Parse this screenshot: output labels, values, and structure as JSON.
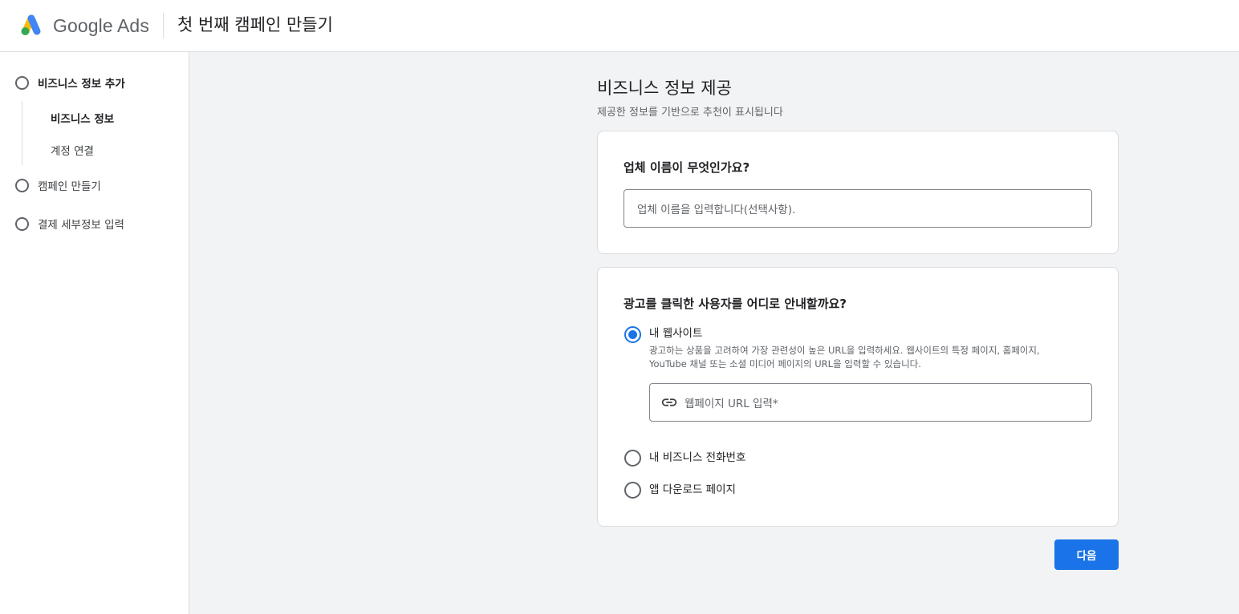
{
  "header": {
    "brand": "Google Ads",
    "title": "첫 번째 캠페인 만들기",
    "logo_colors": {
      "blue": "#4285F4",
      "yellow": "#FBBC04",
      "green": "#34A853"
    }
  },
  "sidebar": {
    "steps": [
      {
        "label": "비즈니스 정보 추가",
        "state": "current"
      },
      {
        "label": "캠페인 만들기",
        "state": "pending"
      },
      {
        "label": "결제 세부정보 입력",
        "state": "pending"
      }
    ],
    "substeps": [
      {
        "label": "비즈니스 정보",
        "active": true
      },
      {
        "label": "계정 연결",
        "active": false
      }
    ]
  },
  "main": {
    "title": "비즈니스 정보 제공",
    "subtitle": "제공한 정보를 기반으로 추천이 표시됩니다",
    "business_name": {
      "question": "업체 이름이 무엇인가요?",
      "placeholder": "업체 이름을 입력합니다(선택사항).",
      "value": ""
    },
    "destination": {
      "question": "광고를 클릭한 사용자를 어디로 안내할까요?",
      "options": [
        {
          "label": "내 웹사이트",
          "checked": true
        },
        {
          "label": "내 비즈니스 전화번호",
          "checked": false
        },
        {
          "label": "앱 다운로드 페이지",
          "checked": false
        }
      ],
      "website_desc_line1": "광고하는 상품을 고려하여 가장 관련성이 높은 URL을 입력하세요. 웹사이트의 특정 페이지, 홈페이지,",
      "website_desc_line2": "YouTube 채널 또는 소셜 미디어 페이지의 URL을 입력할 수 있습니다.",
      "url_placeholder": "웹페이지 URL 입력*",
      "url_icon": "link-icon"
    },
    "next_label": "다음",
    "accent_color": "#1a73e8"
  }
}
